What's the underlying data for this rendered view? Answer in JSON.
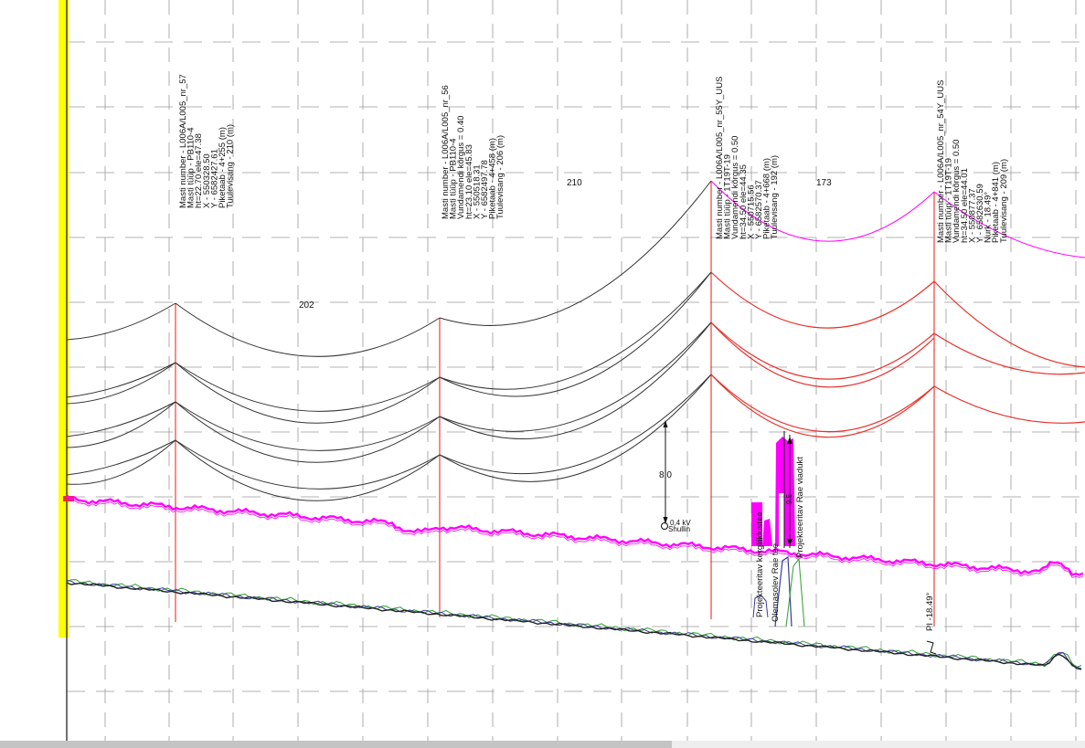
{
  "colors": {
    "highlight": "#ffff00",
    "wire_existing": "#333333",
    "wire_new": "#e8302a",
    "terrain_pink": "#ff00ff",
    "pole": "#e8302a",
    "ground_blue": "#3a3a9a",
    "ground_green": "#2ca02c",
    "grid": "#9a9a9a"
  },
  "masts": [
    {
      "id": "m57",
      "lines": [
        "Masti number - L006A/L005_nr_57",
        "Masti tüüp - PB110-4",
        "ht=22.70 ele=47.38",
        "X - 550328.50",
        "Y - 6582427.61",
        "Piketaab - 4+255 (m)",
        "Tuulevisang - 210 (m)"
      ]
    },
    {
      "id": "m56",
      "lines": [
        "Masti number - L006A/L005_nr_56",
        "Masti tüüp - PB110-4",
        "Vundamendi kõrgus = 0.40",
        "ht=23.10 ele=45.83",
        "X - 550518.31",
        "Y - 6582497.78",
        "Piketaab - 4+458 (m)",
        "Tuulevisang - 206 (m)"
      ]
    },
    {
      "id": "m55",
      "lines": [
        "Masti number - L006A/L005_nr_55Y_UUS",
        "Masti tüüp - 1T19T-19",
        "Vundamendi kõrgus = 0.50",
        "ht=34.50 ele=44.35",
        "X - 550715.56",
        "Y - 6582570.37",
        "Piketaab - 4+668 (m)",
        "Tuulevisang - 192 (m)"
      ]
    },
    {
      "id": "m54",
      "lines": [
        "Masti number - L006A/L005_nr_54Y_UUS",
        "Masti tüüp - 1T19T-19",
        "Vundamendi kõrgus = 0.50",
        "ht=34.50 ele=44.01",
        "X - 550877.37",
        "Y - 6582630.59",
        "Nurk - 18.49°",
        "Piketaab - 4+841 (m)",
        "Tuulevisang - 209 (m)"
      ]
    }
  ],
  "span_labels": [
    "202",
    "210",
    "173"
  ],
  "dimension_label": "8,0",
  "dimension_label_2": "9,5",
  "kv_label": "0,4 kV",
  "shullin_label": "Shullin",
  "crossings": [
    "Projekteeritav kergliiklustee",
    "Olemasolev Rae tee",
    "Projekteeritav Rae viadukt"
  ],
  "pi_label": "PI -18.49°"
}
